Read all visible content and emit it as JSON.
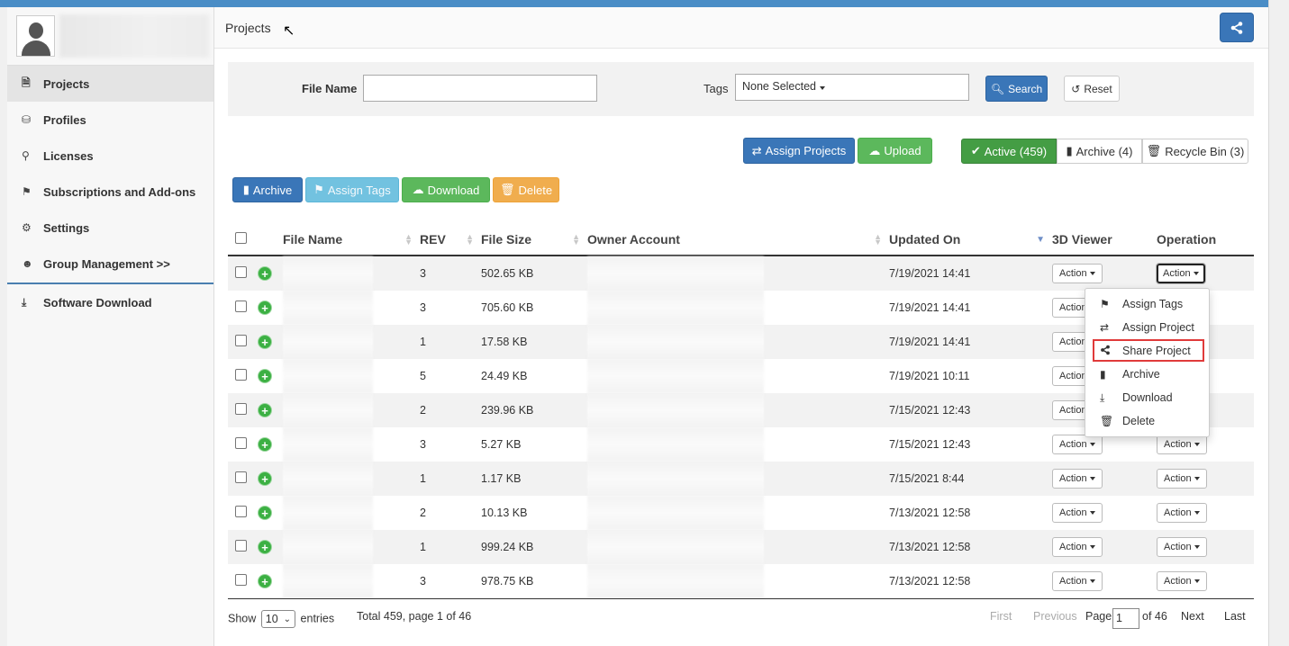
{
  "header": {
    "title": "Projects"
  },
  "sidebar": {
    "items": [
      {
        "label": "Projects",
        "icon": "file-icon"
      },
      {
        "label": "Profiles",
        "icon": "database-icon"
      },
      {
        "label": "Licenses",
        "icon": "key-icon"
      },
      {
        "label": "Subscriptions and Add-ons",
        "icon": "tags-icon"
      },
      {
        "label": "Settings",
        "icon": "gear-icon"
      },
      {
        "label": "Group Management >>",
        "icon": "users-icon"
      },
      {
        "label": "Software Download",
        "icon": "download-icon"
      }
    ]
  },
  "filter": {
    "file_name_label": "File Name",
    "file_name_value": "",
    "tags_label": "Tags",
    "tags_value": "None Selected",
    "search_label": "Search",
    "reset_label": "Reset"
  },
  "toolbar": {
    "assign_projects": "Assign Projects",
    "upload": "Upload",
    "active": "Active (459)",
    "archive_tab": "Archive (4)",
    "recycle": "Recycle Bin (3)",
    "archive": "Archive",
    "assign_tags": "Assign Tags",
    "download": "Download",
    "delete": "Delete"
  },
  "table": {
    "columns": [
      "File Name",
      "REV",
      "File Size",
      "Owner Account",
      "Updated On",
      "3D Viewer",
      "Operation"
    ],
    "action_label": "Action",
    "rows": [
      {
        "rev": "3",
        "size": "502.65 KB",
        "updated": "7/19/2021 14:41"
      },
      {
        "rev": "3",
        "size": "705.60 KB",
        "updated": "7/19/2021 14:41"
      },
      {
        "rev": "1",
        "size": "17.58 KB",
        "updated": "7/19/2021 14:41"
      },
      {
        "rev": "5",
        "size": "24.49 KB",
        "updated": "7/19/2021 10:11"
      },
      {
        "rev": "2",
        "size": "239.96 KB",
        "updated": "7/15/2021 12:43"
      },
      {
        "rev": "3",
        "size": "5.27 KB",
        "updated": "7/15/2021 12:43"
      },
      {
        "rev": "1",
        "size": "1.17 KB",
        "updated": "7/15/2021 8:44"
      },
      {
        "rev": "2",
        "size": "10.13 KB",
        "updated": "7/13/2021 12:58"
      },
      {
        "rev": "1",
        "size": "999.24 KB",
        "updated": "7/13/2021 12:58"
      },
      {
        "rev": "3",
        "size": "978.75 KB",
        "updated": "7/13/2021 12:58"
      }
    ]
  },
  "dropdown": {
    "items": [
      {
        "label": "Assign Tags",
        "icon": "tags-icon"
      },
      {
        "label": "Assign Project",
        "icon": "shuffle-icon"
      },
      {
        "label": "Share Project",
        "icon": "share-icon"
      },
      {
        "label": "Archive",
        "icon": "bookmark-icon"
      },
      {
        "label": "Download",
        "icon": "download-icon"
      },
      {
        "label": "Delete",
        "icon": "trash-icon"
      }
    ]
  },
  "footer": {
    "show_label": "Show",
    "page_size": "10",
    "entries_label": "entries",
    "total": "Total 459, page 1 of 46",
    "first": "First",
    "previous": "Previous",
    "page_label": "Page",
    "page_value": "1",
    "of_pages": "of 46",
    "next": "Next",
    "last": "Last"
  },
  "colors": {
    "accent": "#3a76b8",
    "success": "#5cb85c",
    "warning": "#f0ad4e",
    "info": "#72c2e0",
    "highlight": "#e03a3a"
  }
}
